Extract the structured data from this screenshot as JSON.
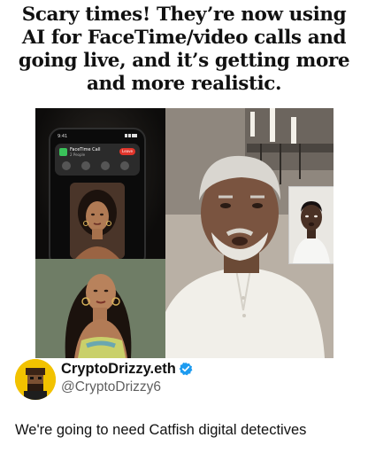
{
  "headline": {
    "lines": [
      "Scary times! They’re now using",
      "AI for FaceTime/video calls and",
      "going live, and it’s getting more",
      "and more realistic."
    ]
  },
  "media": {
    "phone": {
      "status_time": "9:41",
      "call_title": "FaceTime Call",
      "call_subtitle": "2 People",
      "leave_label": "Leave"
    }
  },
  "post": {
    "author": {
      "display_name": "CryptoDrizzy.eth",
      "handle": "@CryptoDrizzy6",
      "verified_icon": "verified-check-icon",
      "verified_color": "#1d9bf0"
    },
    "text": "We're going to need Catfish digital detectives"
  }
}
